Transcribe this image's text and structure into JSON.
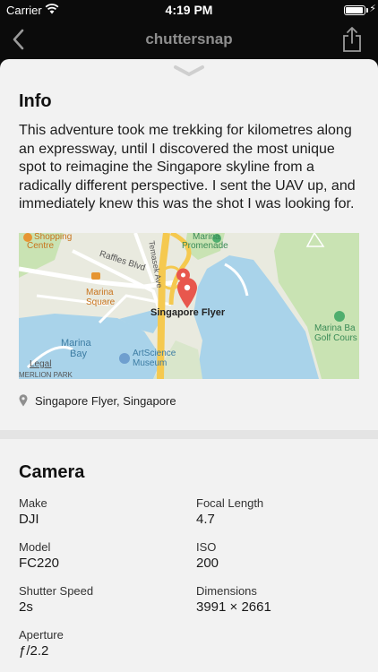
{
  "status_bar": {
    "carrier": "Carrier",
    "time": "4:19 PM",
    "battery_level": 0.95,
    "charging_glyph": "⚡"
  },
  "nav": {
    "title": "chuttersnap",
    "back_icon": "chevron-left-icon",
    "share_icon": "share-icon"
  },
  "info": {
    "title": "Info",
    "description": "This adventure took me trekking for kilometres along an expressway, until I discovered the most unique spot to reimagine the Singapore skyline from a radically different perspective. I sent the UAV up, and immediately knew this was the shot I was looking for."
  },
  "map": {
    "labels": {
      "shopping": "Shopping",
      "centre": "Centre",
      "marina_promenade_1": "Marina",
      "marina_promenade_2": "Promenade",
      "raffles_blvd": "Raffles Blvd",
      "temasek_ave": "Temasek Ave",
      "marina_square_1": "Marina",
      "marina_square_2": "Square",
      "singapore_flyer": "Singapore Flyer",
      "marina_bay_1": "Marina",
      "marina_bay_2": "Bay",
      "artscience_1": "ArtScience",
      "artscience_2": "Museum",
      "golf_1": "Marina Ba",
      "golf_2": "Golf Cours",
      "legal": "Legal",
      "merlion": "MERLION PARK"
    }
  },
  "location": {
    "text": "Singapore Flyer, Singapore"
  },
  "camera": {
    "title": "Camera",
    "specs": {
      "make": {
        "label": "Make",
        "value": "DJI"
      },
      "focal_length": {
        "label": "Focal Length",
        "value": "4.7"
      },
      "model": {
        "label": "Model",
        "value": "FC220"
      },
      "iso": {
        "label": "ISO",
        "value": "200"
      },
      "shutter_speed": {
        "label": "Shutter Speed",
        "value": "2s"
      },
      "dimensions": {
        "label": "Dimensions",
        "value": "3991 × 2661"
      },
      "aperture": {
        "label": "Aperture",
        "value": "ƒ/2.2"
      }
    }
  },
  "colors": {
    "water": "#a9d3ea",
    "park": "#c9e3b3",
    "road": "#f5c94f",
    "pin": "#e8574d"
  }
}
